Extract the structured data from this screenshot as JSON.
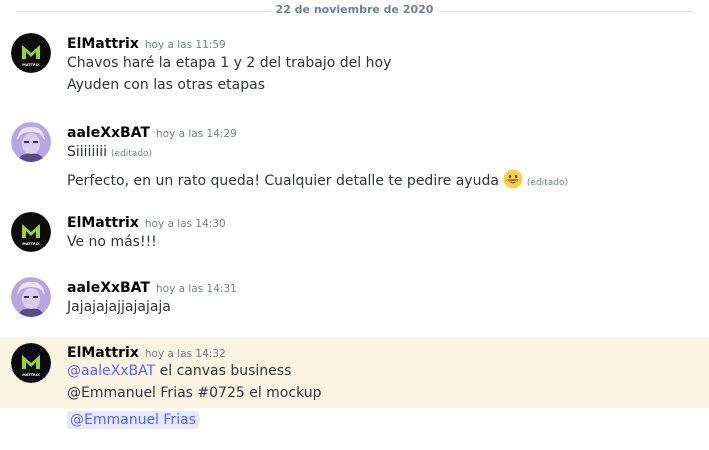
{
  "divider": {
    "date": "22 de noviembre de 2020"
  },
  "users": {
    "elmattrix": "ElMattrix",
    "aalexxbat": "aaleXxBAT"
  },
  "messages": [
    {
      "user": "ElMattrix",
      "time": "hoy a las 11:59",
      "lines": [
        "Chavos haré la etapa  1 y 2 del trabajo del hoy",
        "Ayuden con las otras etapas"
      ]
    },
    {
      "user": "aaleXxBAT",
      "time": "hoy a las 14:29",
      "lines": [
        "Siiiiiiii",
        "Perfecto, en un rato queda! Cualquier detalle te pedire ayuda"
      ],
      "edited": "(editado)"
    },
    {
      "user": "ElMattrix",
      "time": "hoy a las 14:30",
      "lines": [
        "Ve no más!!!"
      ]
    },
    {
      "user": "aaleXxBAT",
      "time": "hoy a las 14:31",
      "lines": [
        "Jajajajajjajajaja"
      ]
    },
    {
      "user": "ElMattrix",
      "time": "hoy a las 14:32",
      "mention1": "@aaleXxBAT",
      "line1_rest": " el canvas business",
      "line2": "@Emmanuel Frias #0725 el mockup",
      "mention2": "@Emmanuel Frias"
    }
  ],
  "avatar_logo_text": "MATTRIX",
  "colors": {
    "accent": "#5865f2",
    "highlight": "#fcf5e3",
    "avatar_green": "#9ed03a"
  },
  "icons": {
    "emoji": "grinning-face-icon"
  }
}
